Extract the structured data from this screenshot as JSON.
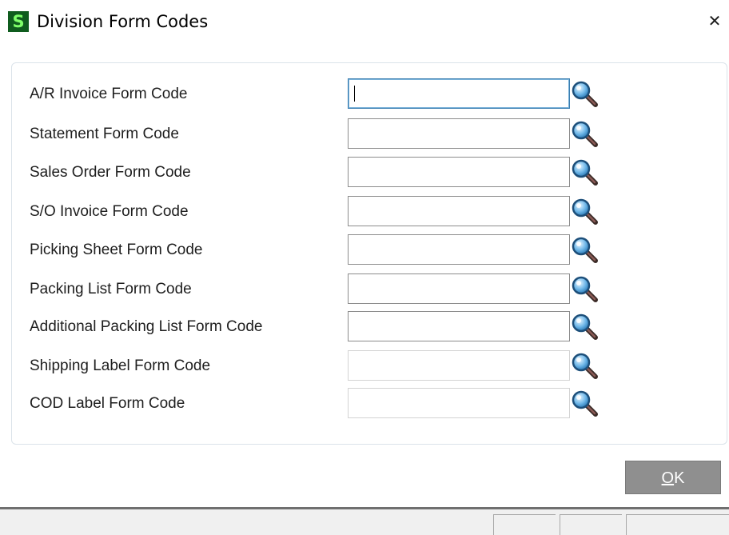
{
  "window": {
    "title": "Division Form Codes",
    "app_icon_letter": "S",
    "close_glyph": "✕"
  },
  "fields": [
    {
      "label": "A/R Invoice Form Code",
      "value": "",
      "state": "focused"
    },
    {
      "label": "Statement Form Code",
      "value": "",
      "state": "enabled"
    },
    {
      "label": "Sales Order Form Code",
      "value": "",
      "state": "enabled"
    },
    {
      "label": "S/O Invoice Form Code",
      "value": "",
      "state": "enabled"
    },
    {
      "label": "Picking Sheet Form Code",
      "value": "",
      "state": "enabled"
    },
    {
      "label": "Packing List Form Code",
      "value": "",
      "state": "enabled"
    },
    {
      "label": "Additional Packing List Form Code",
      "value": "",
      "state": "enabled"
    },
    {
      "label": "Shipping Label Form Code",
      "value": "",
      "state": "disabled"
    },
    {
      "label": "COD Label Form Code",
      "value": "",
      "state": "disabled"
    }
  ],
  "buttons": {
    "ok_accel": "O",
    "ok_rest": "K"
  },
  "icons": {
    "lookup": "magnifier-lookup-icon"
  },
  "colors": {
    "app_icon_bg": "#0f5c1e",
    "app_icon_fg": "#7fff6a",
    "focus_border": "#3c7fb1",
    "ok_button_bg": "#8f8f8f"
  }
}
